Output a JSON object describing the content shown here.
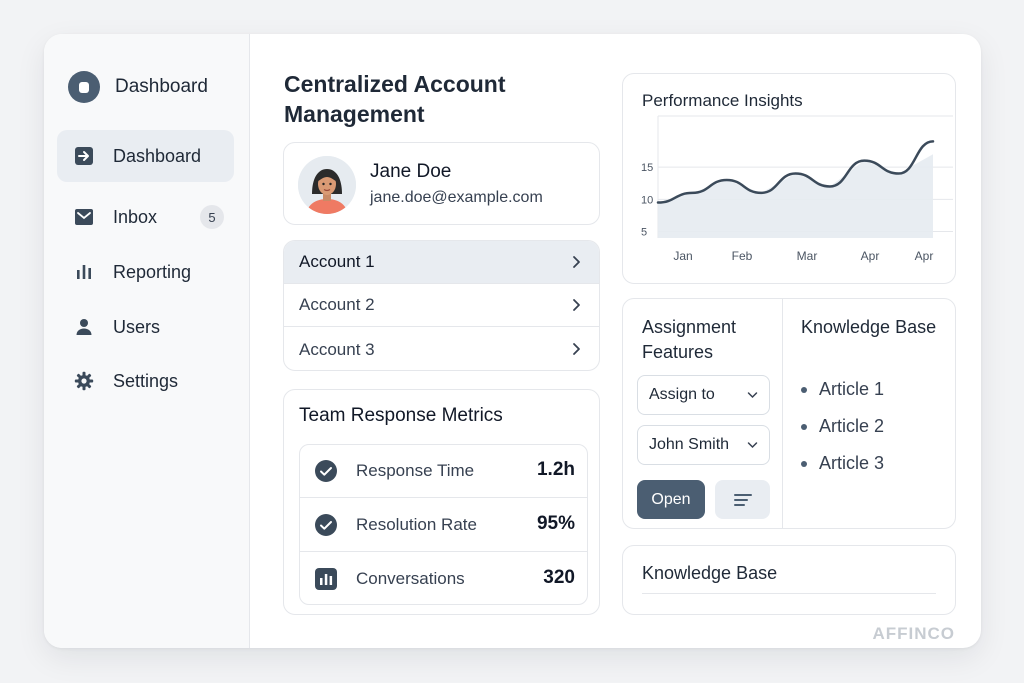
{
  "sidebar": {
    "brand_label": "Dashboard",
    "items": [
      {
        "label": "Dashboard",
        "icon": "arrow-right-square-icon",
        "active": true
      },
      {
        "label": "Inbox",
        "icon": "inbox-icon",
        "badge": "5"
      },
      {
        "label": "Reporting",
        "icon": "bar-chart-icon"
      },
      {
        "label": "Users",
        "icon": "user-icon"
      },
      {
        "label": "Settings",
        "icon": "gear-icon"
      }
    ]
  },
  "main": {
    "title": "Centralized Account Management",
    "profile": {
      "name": "Jane Doe",
      "email": "jane.doe@example.com"
    },
    "accounts": [
      {
        "label": "Account 1",
        "active": true
      },
      {
        "label": "Account 2"
      },
      {
        "label": "Account 3"
      }
    ],
    "metrics": {
      "title": "Team Response Metrics",
      "rows": [
        {
          "label": "Response Time",
          "value": "1.2h",
          "icon": "check-circle-icon"
        },
        {
          "label": "Resolution Rate",
          "value": "95%",
          "icon": "check-circle-icon"
        },
        {
          "label": "Conversations",
          "value": "320",
          "icon": "bar-chart-icon"
        }
      ]
    }
  },
  "performance": {
    "title": "Performance Insights"
  },
  "chart_data": {
    "type": "line",
    "x": [
      "Jan",
      "Feb",
      "Mar",
      "Apr",
      "Apr"
    ],
    "y_ticks": [
      "5",
      "10",
      "15"
    ],
    "ylim": [
      4,
      22
    ],
    "series": [
      {
        "values": [
          9.5,
          11,
          13,
          11,
          14,
          12,
          16,
          14,
          19
        ]
      }
    ],
    "area_values": [
      9.5,
      11,
      13,
      11,
      14,
      12,
      16,
      14,
      17
    ],
    "grid": true
  },
  "assignment": {
    "title": "Assignment Features",
    "assign_select": "Assign to",
    "user_select": "John Smith",
    "open_label": "Open"
  },
  "knowledge": {
    "title": "Knowledge Base",
    "articles": [
      "Article 1",
      "Article 2",
      "Article 3"
    ]
  },
  "knowledge_card": {
    "title": "Knowledge Base"
  },
  "watermark": "AFFINCO",
  "colors": {
    "accent": "#4b5e72",
    "active_bg": "#e9edf2",
    "border": "#e5e7eb"
  }
}
